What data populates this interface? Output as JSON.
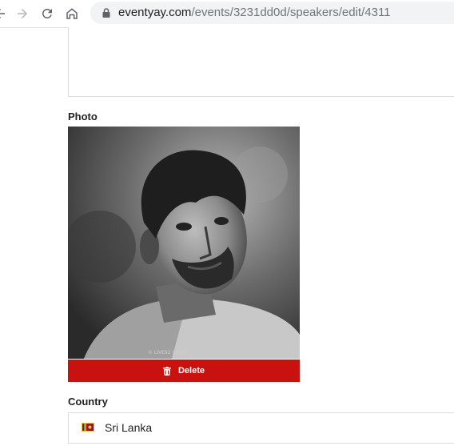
{
  "browser": {
    "url_domain": "eventyay.com",
    "url_path": "/events/3231dd0d/speakers/edit/4311",
    "icons": [
      "back-arrow-icon",
      "forward-arrow-icon",
      "reload-icon",
      "home-icon",
      "lock-icon"
    ]
  },
  "form": {
    "photo_label": "Photo",
    "photo_watermark": "© LIVE92 | 2015",
    "delete_label": "Delete",
    "country_label": "Country",
    "country_value": "Sri Lanka"
  },
  "colors": {
    "delete_button": "#c9120f",
    "text": "#222222"
  }
}
